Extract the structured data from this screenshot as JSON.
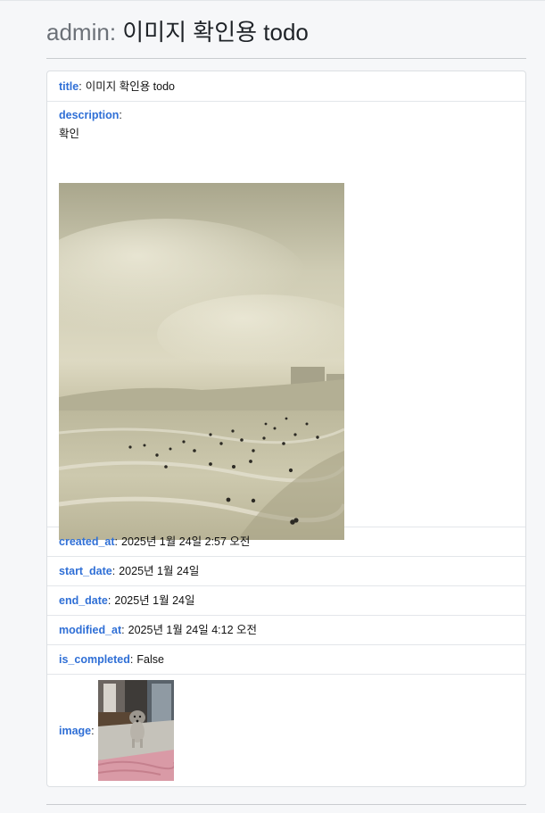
{
  "header": {
    "prefix": "admin",
    "separator": ":",
    "title": "이미지 확인용 todo"
  },
  "fields": {
    "title": {
      "name": "title",
      "value": "이미지 확인용 todo"
    },
    "description": {
      "name": "description",
      "value": "확인"
    },
    "created_at": {
      "name": "created_at",
      "value": "2025년 1월 24일 2:57 오전"
    },
    "start_date": {
      "name": "start_date",
      "value": "2025년 1월 24일"
    },
    "end_date": {
      "name": "end_date",
      "value": "2025년 1월 24일"
    },
    "modified_at": {
      "name": "modified_at",
      "value": "2025년 1월 24일 4:12 오전"
    },
    "is_completed": {
      "name": "is_completed",
      "value": "False"
    },
    "image": {
      "name": "image"
    }
  },
  "colon": ":",
  "colors": {
    "field_label": "#2f6fd6",
    "background": "#f6f7f9",
    "card": "#ffffff"
  }
}
